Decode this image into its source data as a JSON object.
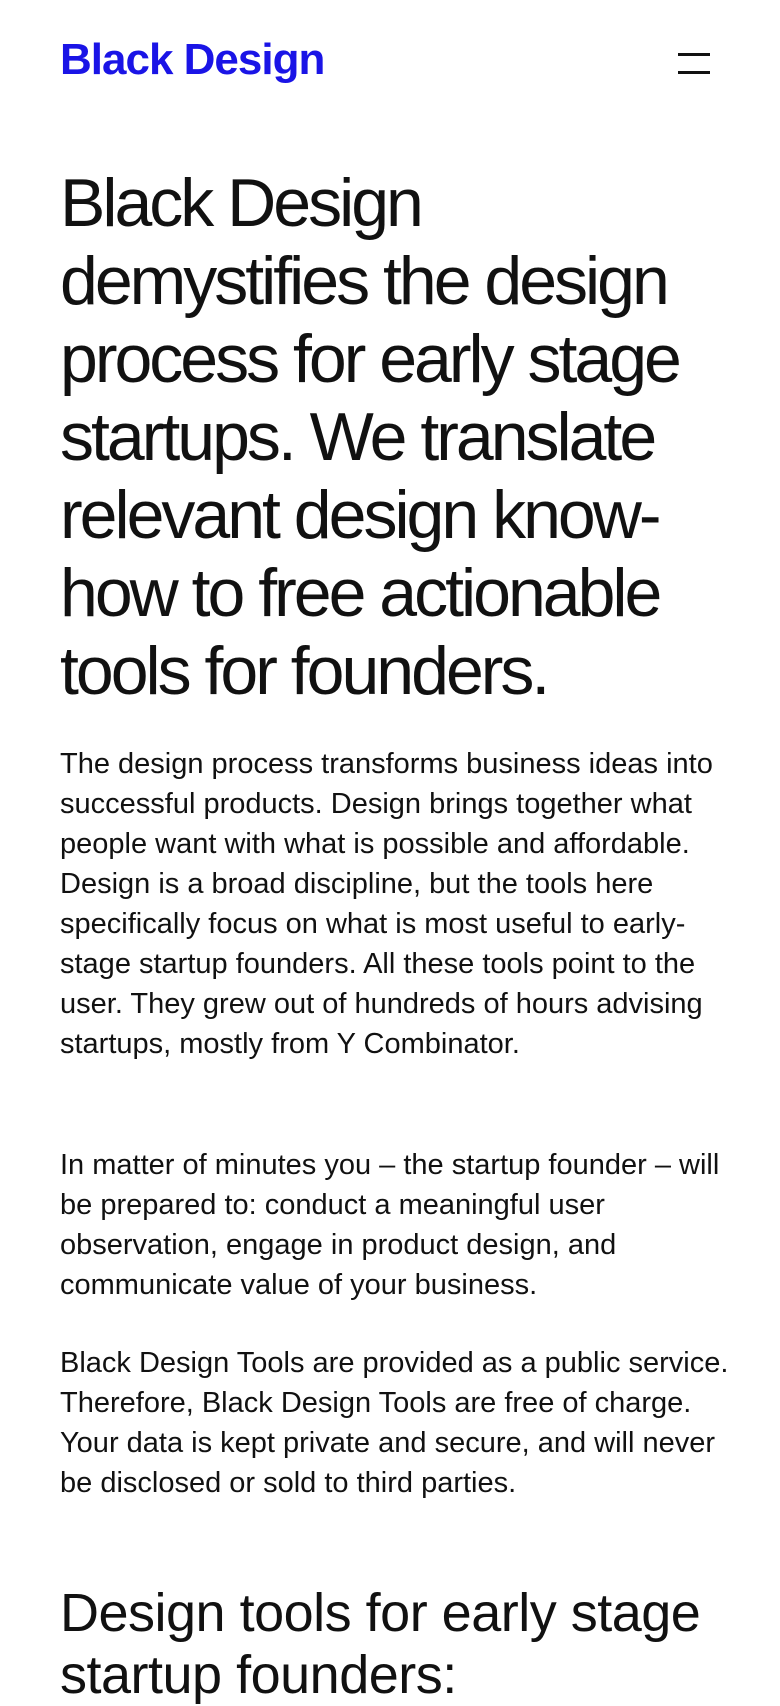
{
  "header": {
    "brand": "Black Design",
    "menu_icon": "hamburger-menu-icon"
  },
  "hero": {
    "title": "Black Design demystifies the design process for early stage startups. We translate relevant design know-how to free actionable tools for founders."
  },
  "intro": {
    "paragraphs": [
      "The design process transforms business ideas into successful products. Design brings together what people want with what is possible and affordable. Design is a broad discipline, but the tools here specifically focus on what is most useful to early-stage startup founders. All these tools point to the user. They grew out of hundreds of hours advising startups, mostly from Y Combinator.",
      "In matter of minutes you – the startup founder – will be prepared to: conduct a meaningful user observation, engage in product design, and communicate value of your business.",
      "Black Design Tools are provided as a public service. Therefore, Black Design Tools are free of charge. Your data is kept private and secure, and will never be disclosed or sold to third parties."
    ]
  },
  "tools_section": {
    "title": "Design tools for early stage startup founders:"
  },
  "colors": {
    "brand": "#1a14e6",
    "text": "#111111",
    "background": "#ffffff"
  }
}
